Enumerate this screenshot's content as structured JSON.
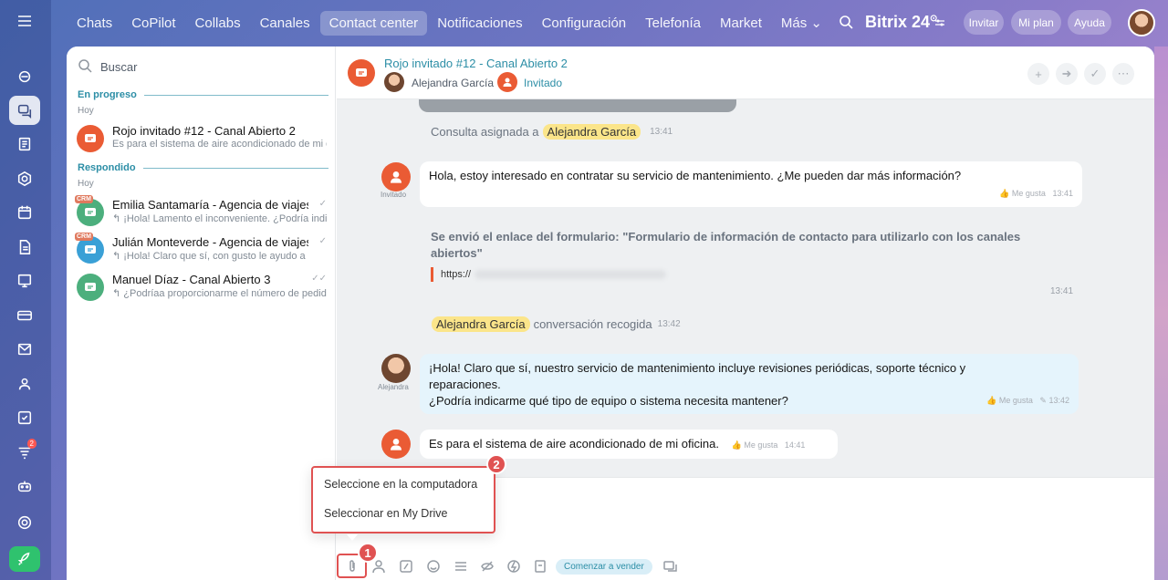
{
  "top_nav": {
    "items": [
      "Chats",
      "CoPilot",
      "Collabs",
      "Canales",
      "Contact center",
      "Notificaciones",
      "Configuración",
      "Telefonía",
      "Market",
      "Más ⌄"
    ],
    "active_index": 4,
    "brand": "Bitrix 24",
    "brand_mark": "⊙",
    "invite": "Invitar",
    "my_plan": "Mi plan",
    "help": "Ayuda"
  },
  "rail": {
    "notification_count": "2",
    "icons": [
      "copilot-icon",
      "chats-icon",
      "feed-icon",
      "collabs-icon",
      "calendar-icon",
      "docs-icon",
      "board-icon",
      "crm-icon",
      "mail-icon",
      "groups-icon",
      "tasks-icon",
      "filter-icon",
      "robot-icon",
      "settings-icon",
      "rocket-icon"
    ]
  },
  "chat_list": {
    "search_placeholder": "Buscar",
    "sections": [
      {
        "title": "En progreso",
        "day": "Hoy",
        "items": [
          {
            "title": "Rojo invitado #12 - Canal Abierto 2",
            "preview": "Es para el sistema de aire acondicionado de mi oficina."
          }
        ]
      },
      {
        "title": "Respondido",
        "day": "Hoy",
        "items": [
          {
            "title": "Emilia Santamaría - Agencia de viajes",
            "preview": "↰ ¡Hola! Lamento el inconveniente. ¿Podría indicarme",
            "badge": "CRM"
          },
          {
            "title": "Julián Monteverde - Agencia de viajes",
            "preview": "↰ ¡Hola! Claro que sí, con gusto le ayudo a",
            "badge": "CRM"
          },
          {
            "title": "Manuel Díaz - Canal Abierto 3",
            "preview": "↰ ¿Podríaa proporcionarme el número de pedido"
          }
        ]
      }
    ]
  },
  "conversation": {
    "title": "Rojo invitado #12 - Canal Abierto 2",
    "operator": "Alejandra García",
    "guest_status": "Invitado",
    "messages": {
      "assigned": {
        "text": "Consulta asignada a",
        "name": "Alejandra García",
        "time": "13:41"
      },
      "guest1": {
        "author": "Invitado",
        "text": "Hola, estoy interesado en contratar su servicio de mantenimiento. ¿Me pueden dar más información?",
        "like": "Me gusta",
        "time": "13:41"
      },
      "form": {
        "text": "Se envió el enlace del formulario: \"Formulario de información de contacto para utilizarlo con los canales abiertos\"",
        "url": "https://",
        "time": "13:41"
      },
      "picked": {
        "name": "Alejandra García",
        "text": "conversación recogida",
        "time": "13:42"
      },
      "operator1": {
        "author": "Alejandra",
        "line1": "¡Hola! Claro que sí, nuestro servicio de mantenimiento incluye revisiones periódicas, soporte técnico y reparaciones.",
        "line2": "¿Podría indicarme qué tipo de equipo o sistema necesita mantener?",
        "like": "Me gusta",
        "time": "✎ 13:42"
      },
      "guest2": {
        "text": "Es para el sistema de aire acondicionado de mi oficina.",
        "like": "Me gusta",
        "time": "14:41"
      }
    }
  },
  "composer": {
    "sell_label": "Comenzar a vender"
  },
  "attach_menu": {
    "from_computer": "Seleccione en la computadora",
    "from_drive": "Seleccionar en My Drive"
  },
  "callouts": {
    "one": "1",
    "two": "2"
  },
  "colors": {
    "accent": "#2c8ea6",
    "guest": "#ea5b34",
    "highlight": "#fbe58a",
    "callout": "#e05252"
  }
}
